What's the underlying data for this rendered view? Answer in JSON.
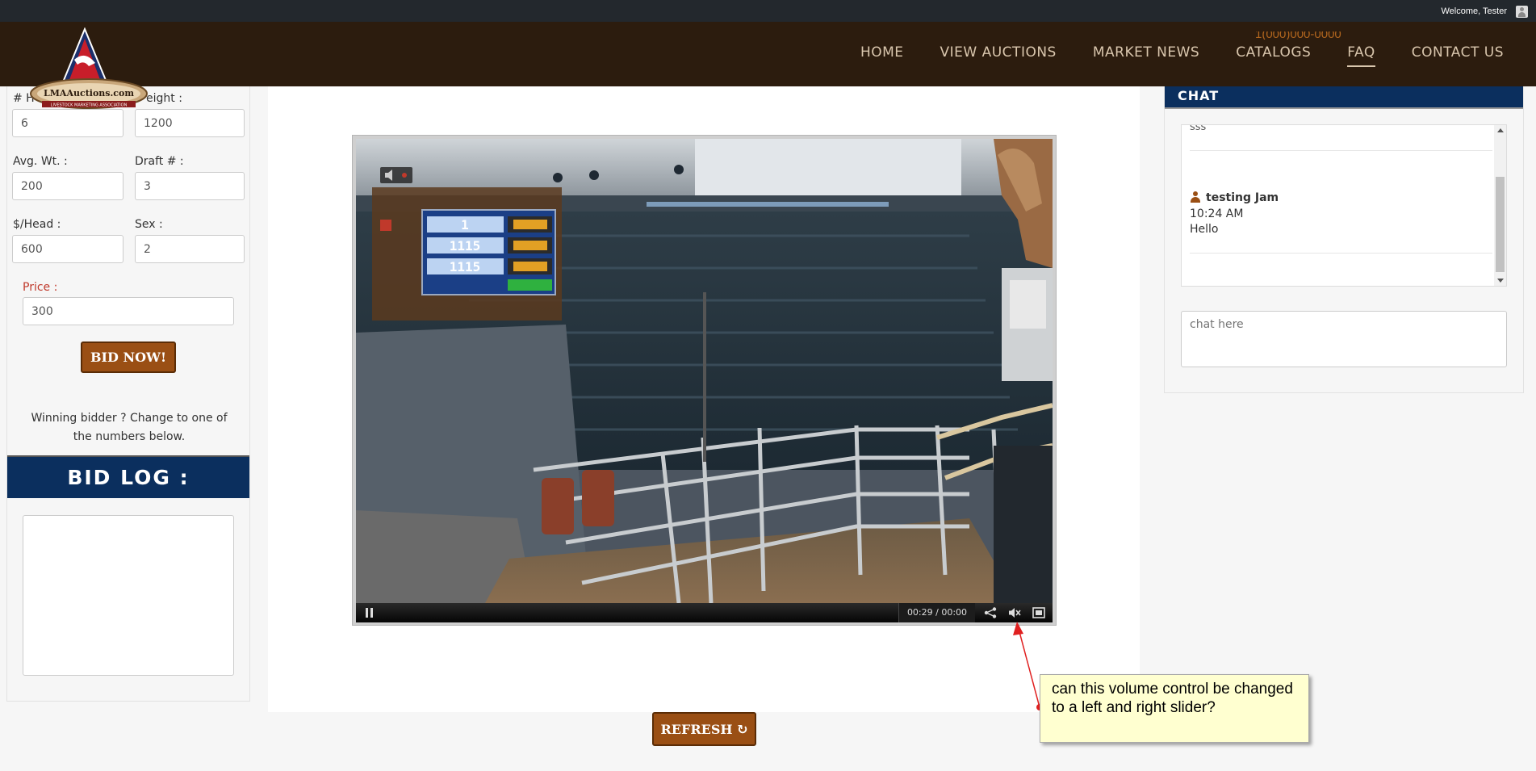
{
  "topbar": {
    "welcome": "Welcome, Tester"
  },
  "header": {
    "phone_partial": "1(000)000-0000",
    "logo_text": "LMAAuctions.com",
    "logo_subtext": "LIVESTOCK MARKETING ASSOCIATION",
    "nav": [
      {
        "label": "HOME"
      },
      {
        "label": "VIEW AUCTIONS"
      },
      {
        "label": "MARKET NEWS"
      },
      {
        "label": "CATALOGS"
      },
      {
        "label": "FAQ"
      },
      {
        "label": "CONTACT US"
      }
    ]
  },
  "bid_form": {
    "head_label": "# H",
    "head_value": "6",
    "weight_label": "eight :",
    "weight_value": "1200",
    "avg_wt_label": "Avg. Wt. :",
    "avg_wt_value": "200",
    "draft_label": "Draft # :",
    "draft_value": "3",
    "per_head_label": "$/Head :",
    "per_head_value": "600",
    "sex_label": "Sex :",
    "sex_value": "2",
    "price_label": "Price :",
    "price_value": "300",
    "bid_button": "BID NOW!",
    "winning_text": "Winning bidder ? Change to one of the numbers below.",
    "bid_log_title": "BID LOG :"
  },
  "player": {
    "time": "00:29 / 00:00",
    "muted": true,
    "overlay_numbers": [
      "1",
      "1115",
      "1115"
    ]
  },
  "refresh_button": "REFRESH",
  "chat": {
    "title": "CHAT",
    "prev_message": "sss",
    "messages": [
      {
        "user": "testing Jam",
        "time": "10:24 AM",
        "text": "Hello"
      }
    ],
    "input_placeholder": "chat here"
  },
  "annotation": {
    "text": "can this volume control be changed to a left and right slider?",
    "color": "#ff0000"
  },
  "colors": {
    "header_bg": "#2c1c0e",
    "nav_text": "#d9c6ad",
    "navy": "#0b2f5e",
    "button_brown": "#9a4f14",
    "price_red": "#c0392b"
  }
}
